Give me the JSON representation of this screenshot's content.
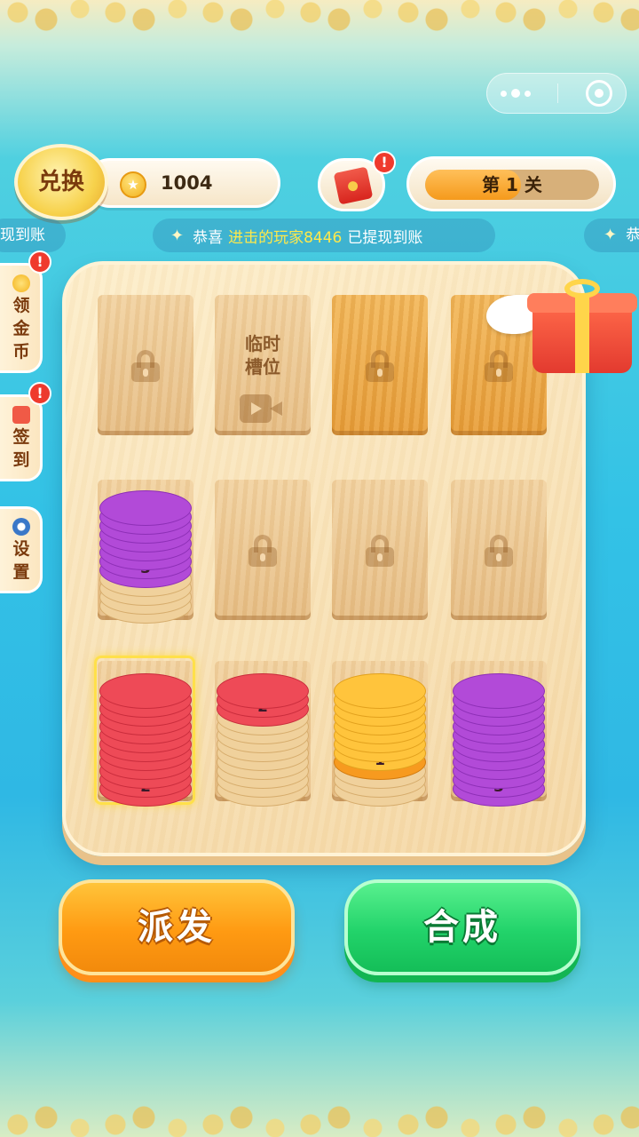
{
  "capsule": {
    "more_icon": "more-dots-icon",
    "close_icon": "target-icon"
  },
  "header": {
    "exchange_label": "兑换",
    "coin_count": "1004",
    "level_prefix": "第",
    "level_number": "1",
    "level_suffix": "关",
    "level_text": "第 1 关",
    "level_progress": 0.55
  },
  "badges": {
    "alert": "!"
  },
  "ticker": {
    "left_fragment": "现到账",
    "prefix": "恭喜",
    "highlight": "进击的玩家8446",
    "suffix": "已提现到账",
    "right_fragment": "恭"
  },
  "sidebar": [
    {
      "label_lines": [
        "领",
        "金",
        "币"
      ],
      "icon": "coin-icon"
    },
    {
      "label_lines": [
        "签",
        "到"
      ],
      "icon": "calendar-icon"
    },
    {
      "label_lines": [
        "设",
        "置"
      ],
      "icon": "gear-icon"
    }
  ],
  "board": {
    "temp_slot_lines": [
      "临时",
      "槽位"
    ],
    "stacks": [
      {
        "color": "purple",
        "count": 8,
        "number": "3"
      },
      {
        "color": "red",
        "count": 12,
        "number": "2"
      },
      {
        "color": "red",
        "count": 3,
        "number": "2"
      },
      {
        "color": "orange",
        "count": 9,
        "number": "1"
      },
      {
        "color": "purple",
        "count": 12,
        "number": "3"
      }
    ]
  },
  "buttons": {
    "dispatch": "派发",
    "merge": "合成"
  },
  "colors": {
    "purple": "#b24ad8",
    "red": "#ee4a57",
    "yellow": "#ffc43c",
    "orange": "#f79a1f",
    "dispatch_button": "#ff9a12",
    "merge_button": "#22d36a"
  }
}
